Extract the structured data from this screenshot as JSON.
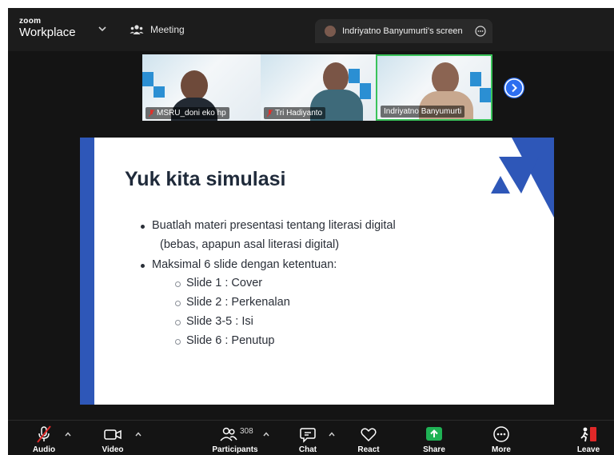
{
  "window": {
    "logo_top": "zoom",
    "logo_bottom": "Workplace",
    "meeting_label": "Meeting",
    "share_tab_label": "Indriyatno Banyumurti's screen"
  },
  "participants": [
    {
      "name": "MSRU_doni eko hp",
      "muted": true
    },
    {
      "name": "Tri Hadiyanto",
      "muted": true
    },
    {
      "name": "Indriyatno Banyumurti",
      "muted": false
    }
  ],
  "slide": {
    "title": "Yuk kita simulasi",
    "bullet1_line1": "Buatlah materi presentasi tentang literasi digital",
    "bullet1_line2": "(bebas, apapun asal literasi digital)",
    "bullet2": "Maksimal 6 slide dengan ketentuan:",
    "sub_items": [
      "Slide 1 : Cover",
      "Slide 2 : Perkenalan",
      "Slide 3-5 : Isi",
      "Slide 6 : Penutup"
    ],
    "accent_color": "#2e57b8"
  },
  "toolbar": {
    "audio": "Audio",
    "video": "Video",
    "participants": "Participants",
    "participants_count": "308",
    "chat": "Chat",
    "react": "React",
    "share": "Share",
    "more": "More",
    "leave": "Leave"
  },
  "colors": {
    "share_green": "#1fb255",
    "leave_red": "#e02828",
    "active_border": "#39c35a"
  }
}
